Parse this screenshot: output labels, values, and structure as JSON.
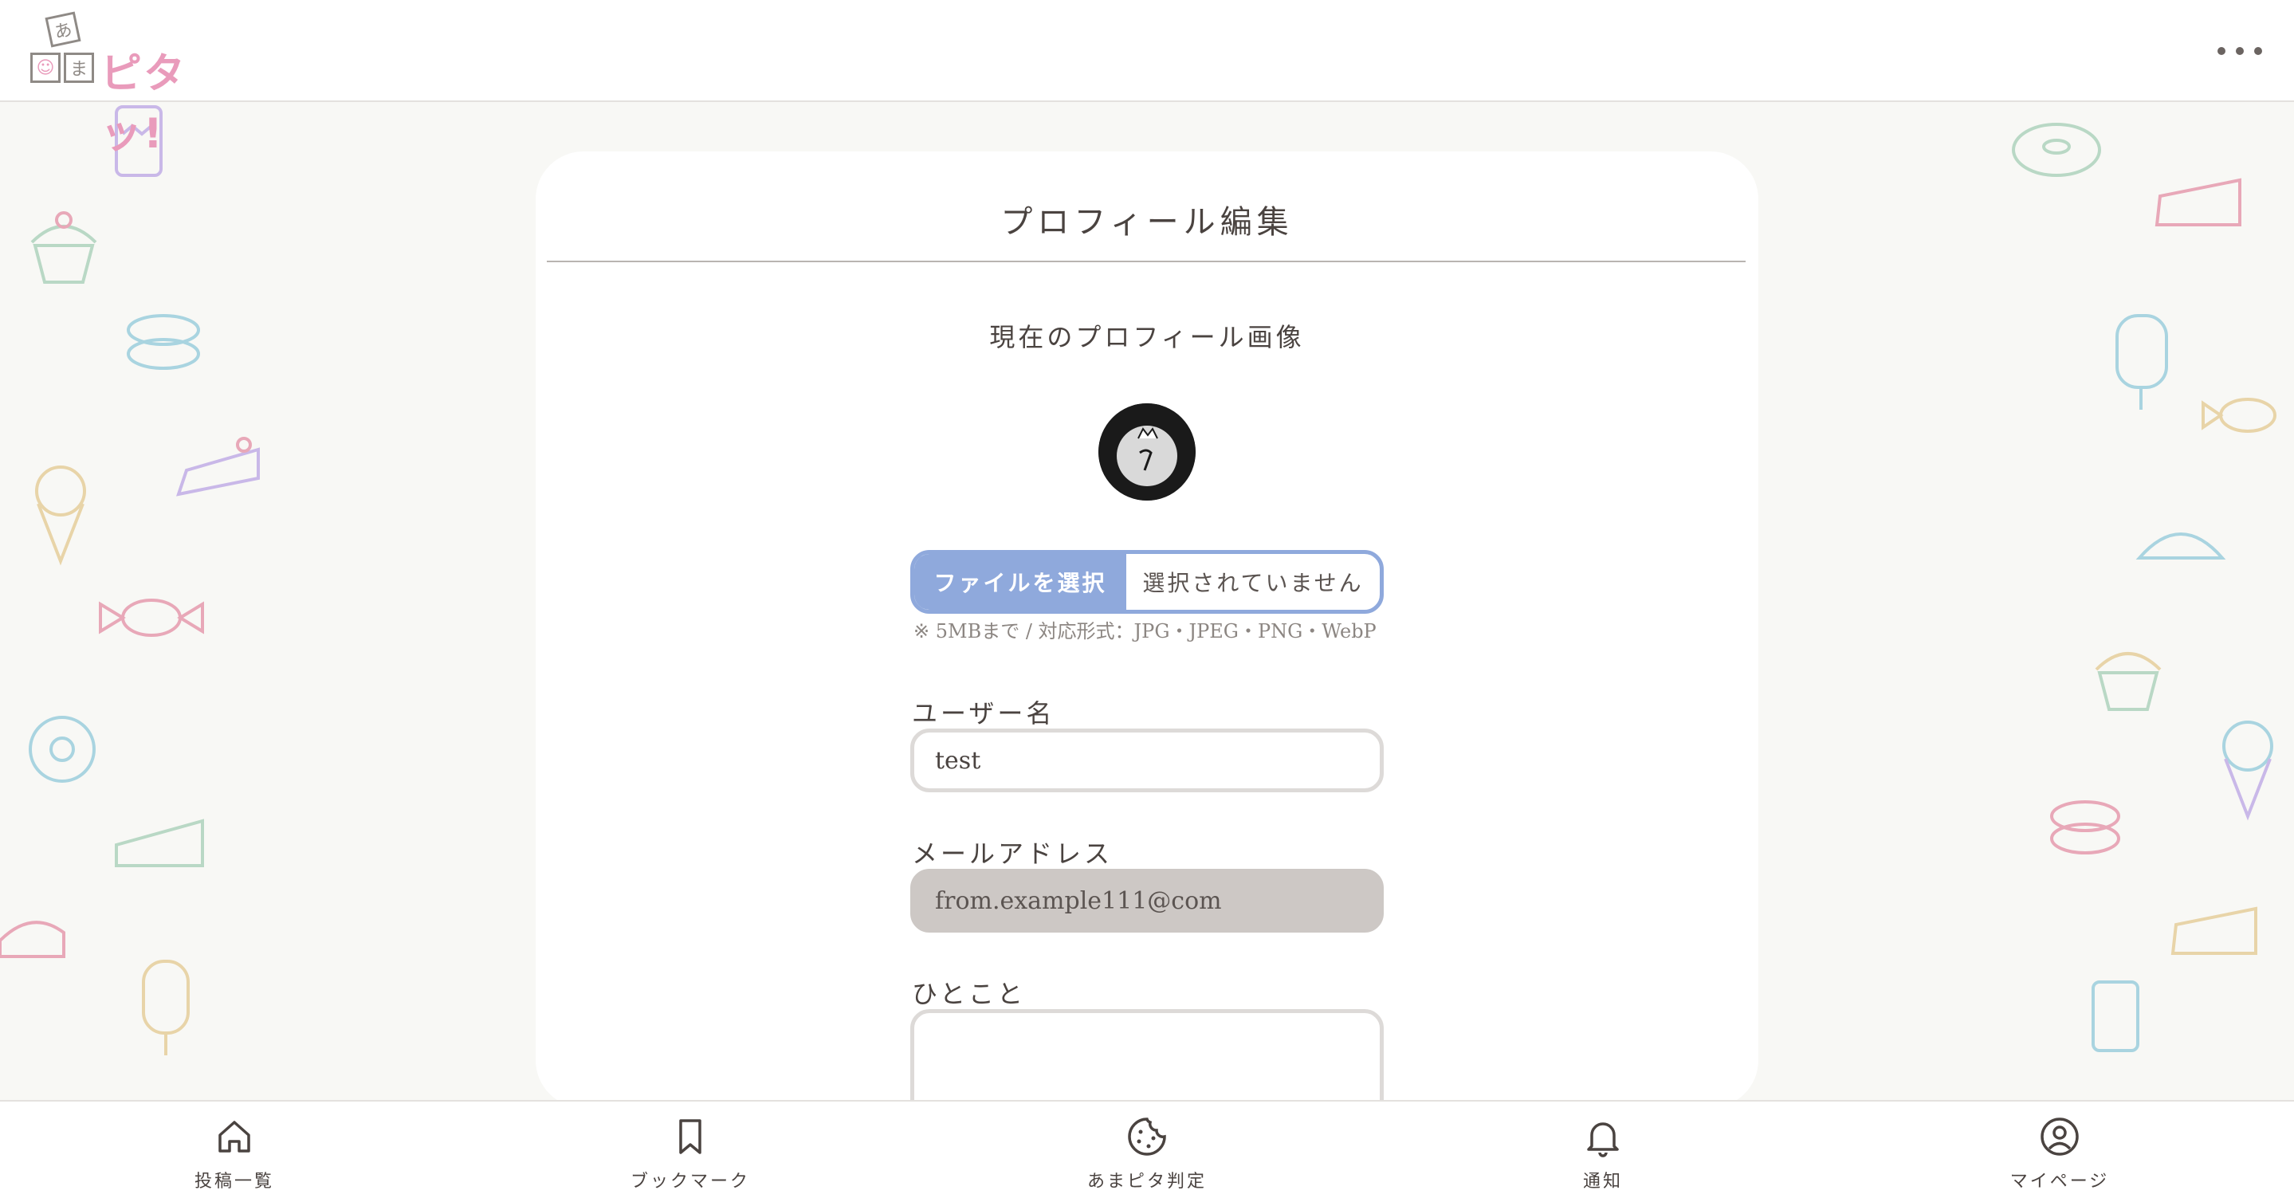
{
  "app": {
    "logo_line1": "あ",
    "logo_line2a": "☺",
    "logo_line2b": "ま",
    "logo_text": "ピタッ!"
  },
  "colors": {
    "accent": "#8fa9dc",
    "logo_pink": "#e99bbb",
    "disabled_bg": "#cdc8c5",
    "page_bg": "#f8f8f5"
  },
  "icons": {
    "menu": "more-horizontal-icon"
  },
  "card": {
    "title": "プロフィール編集",
    "current_image_label": "現在のプロフィール画像",
    "file_button_label": "ファイルを選択",
    "file_status": "選択されていません",
    "file_note": "※ 5MBまで / 対応形式：JPG・JPEG・PNG・WebP",
    "username_label": "ユーザー名",
    "username_value": "test",
    "email_label": "メールアドレス",
    "email_value": "from.example111@com",
    "bio_label": "ひとこと",
    "bio_value": ""
  },
  "bottom_nav": {
    "items": [
      {
        "label": "投稿一覧",
        "icon": "home-icon"
      },
      {
        "label": "ブックマーク",
        "icon": "bookmark-icon"
      },
      {
        "label": "あまピタ判定",
        "icon": "cookie-icon"
      },
      {
        "label": "通知",
        "icon": "bell-icon"
      },
      {
        "label": "マイページ",
        "icon": "user-circle-icon"
      }
    ]
  }
}
